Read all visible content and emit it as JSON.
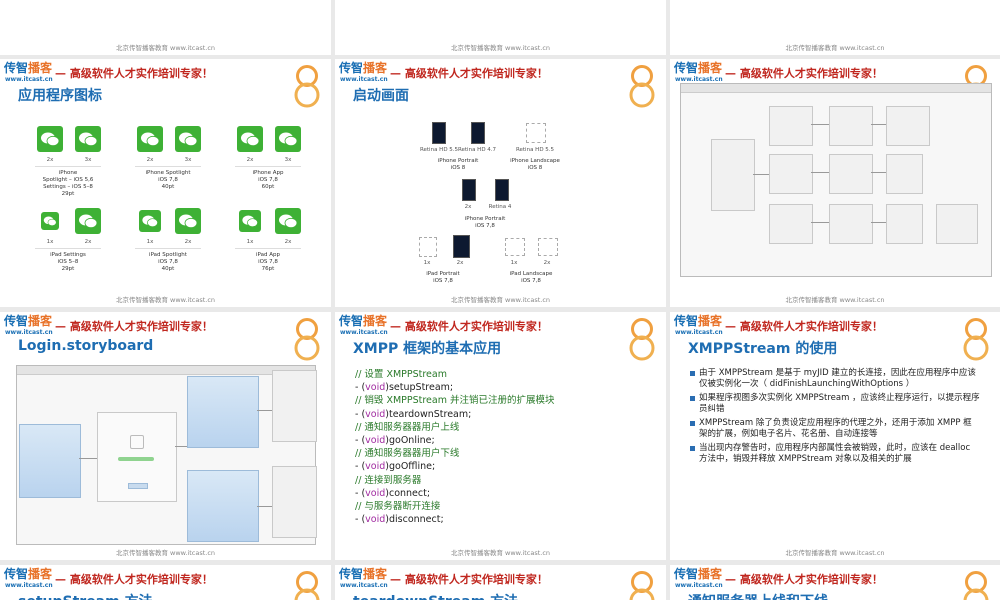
{
  "footer_text": "北京传智播客教育 www.itcast.cn",
  "header": {
    "logo_part1": "传智",
    "logo_part2": "播客",
    "logo_url": "www.itcast.cn",
    "tagline": "— 高级软件人才实作培训专家！"
  },
  "slides": {
    "app_icons": {
      "title": "应用程序图标",
      "groups": [
        {
          "sizes": [
            "2x",
            "3x"
          ],
          "caption": [
            "iPhone",
            "Spotlight – iOS 5,6",
            "Settings – iOS 5–8",
            "29pt"
          ]
        },
        {
          "sizes": [
            "2x",
            "3x"
          ],
          "caption": [
            "iPhone Spotlight",
            "iOS 7,8",
            "40pt"
          ]
        },
        {
          "sizes": [
            "2x",
            "3x"
          ],
          "caption": [
            "iPhone App",
            "iOS 7,8",
            "60pt"
          ]
        },
        {
          "sizes": [
            "1x",
            "2x"
          ],
          "caption": [
            "iPad Settings",
            "iOS 5–8",
            "29pt"
          ]
        },
        {
          "sizes": [
            "1x",
            "2x"
          ],
          "caption": [
            "iPad Spotlight",
            "iOS 7,8",
            "40pt"
          ]
        },
        {
          "sizes": [
            "1x",
            "2x"
          ],
          "caption": [
            "iPad App",
            "iOS 7,8",
            "76pt"
          ]
        }
      ]
    },
    "launch": {
      "title": "启动画面",
      "labels": {
        "retina55": "Retina HD 5.5",
        "retina47": "Retina HD 4.7",
        "retina55b": "Retina HD 5.5",
        "portrait8": "iPhone Portrait\niOS 8",
        "landscape8": "iPhone Landscape\niOS 8",
        "x2": "2x",
        "retina4": "Retina 4",
        "portrait78": "iPhone Portrait\niOS 7,8",
        "ipadp_1x": "1x",
        "ipadp_2x": "2x",
        "ipadl_1x": "1x",
        "ipadl_2x": "2x",
        "ipad_portrait": "iPad Portrait\niOS 7,8",
        "ipad_landscape": "iPad Landscape\niOS 7,8"
      }
    },
    "login": {
      "title": "Login.storyboard"
    },
    "xmpp_basic": {
      "title": "XMPP 框架的基本应用",
      "lines": [
        {
          "type": "comment",
          "text": "//  设置 XMPPStream"
        },
        {
          "type": "code",
          "kw": "void",
          "name": "setupStream;"
        },
        {
          "type": "comment",
          "text": "//  销毁 XMPPStream 并注销已注册的扩展模块"
        },
        {
          "type": "code",
          "kw": "void",
          "name": "teardownStream;"
        },
        {
          "type": "comment",
          "text": "//  通知服务器器用户上线"
        },
        {
          "type": "code",
          "kw": "void",
          "name": "goOnline;"
        },
        {
          "type": "comment",
          "text": "//  通知服务器器用户下线"
        },
        {
          "type": "code",
          "kw": "void",
          "name": "goOffline;"
        },
        {
          "type": "comment",
          "text": "//  连接到服务器"
        },
        {
          "type": "code",
          "kw": "void",
          "name": "connect;"
        },
        {
          "type": "comment",
          "text": "//  与服务器断开连接"
        },
        {
          "type": "code",
          "kw": "void",
          "name": "disconnect;"
        }
      ]
    },
    "xmppstream_use": {
      "title": "XMPPStream 的使用",
      "bullets": [
        "由于 XMPPStream 是基于 myJID 建立的长连接，因此在应用程序中应该仅被实例化一次（ didFinishLaunchingWithOptions ）",
        "如果程序视图多次实例化 XMPPStream ，应该终止程序运行，以提示程序员纠错",
        "XMPPStream 除了负责设定应用程序的代理之外，还用于添加 XMPP 框架的扩展，例如电子名片、花名册、自动连接等",
        "当出现内存警告时，应用程序内部属性会被销毁，此时，应该在 dealloc 方法中，销毁并释放 XMPPStream 对象以及相关的扩展"
      ]
    },
    "bottom": [
      {
        "title": "setupStream 方法"
      },
      {
        "title": "teardownStream 方法"
      },
      {
        "title": "通知服务器上线和下线"
      }
    ]
  },
  "colors": {
    "brand_blue": "#1e6db2",
    "brand_red": "#c0271f",
    "wechat_green": "#3eb135"
  }
}
